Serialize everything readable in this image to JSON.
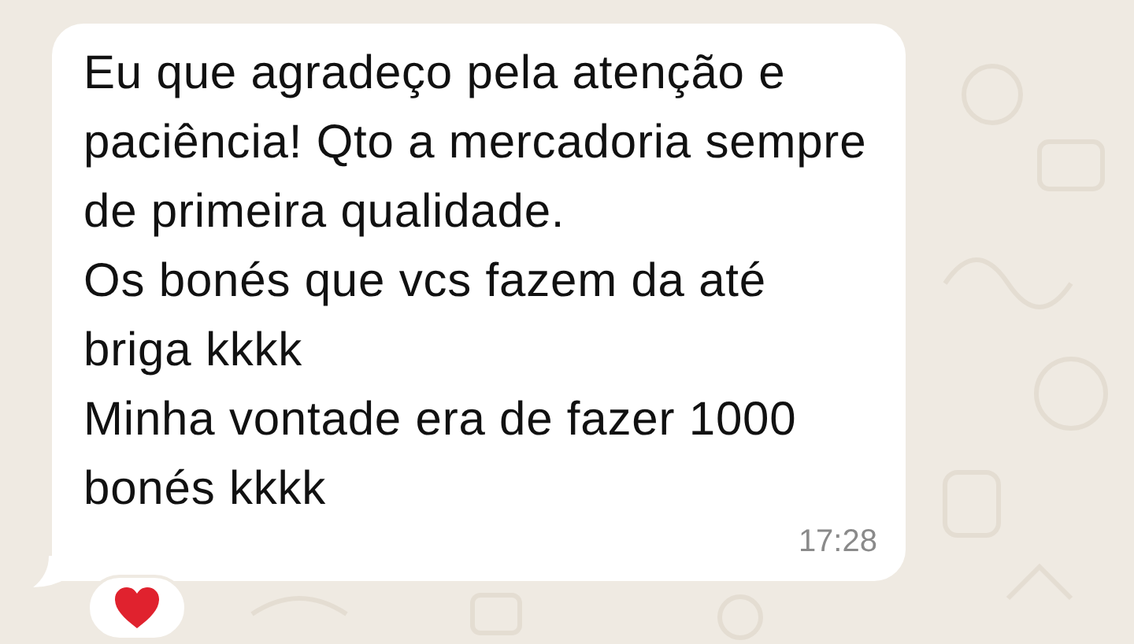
{
  "message": {
    "text": "Eu que agradeço pela atenção e paciência! Qto a mercadoria sempre de primeira qualidade.\nOs bonés que vcs fazem da até briga kkkk\nMinha vontade era de fazer 1000 bonés kkkk",
    "time": "17:28",
    "reaction": {
      "kind": "heart"
    }
  }
}
